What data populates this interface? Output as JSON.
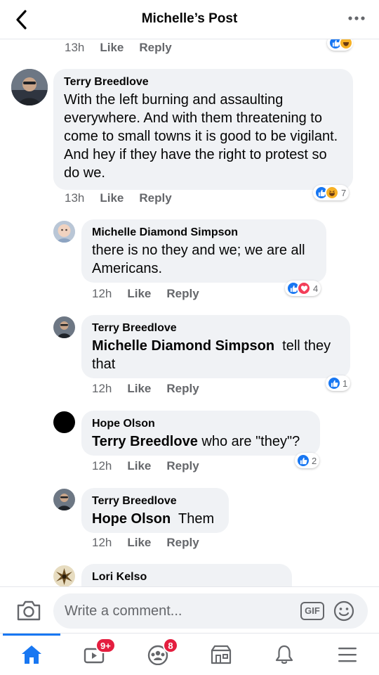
{
  "header": {
    "title": "Michelle’s Post"
  },
  "top_meta": {
    "time": "13h",
    "like": "Like",
    "reply": "Reply"
  },
  "comments": [
    {
      "author": "Terry Breedlove",
      "text": "With the left burning and assaulting everywhere. And with them threatening to come to small towns it is good to be vigilant. And hey if they have the right to protest so do we.",
      "time": "13h",
      "like": "Like",
      "reply": "Reply",
      "reactions": {
        "icons": [
          "like-icon",
          "haha-icon"
        ],
        "count": "7"
      }
    },
    {
      "author": "Michelle Diamond Simpson",
      "text": "there is no they and we; we are all Americans.",
      "time": "12h",
      "like": "Like",
      "reply": "Reply",
      "reactions": {
        "icons": [
          "like-icon",
          "love-icon"
        ],
        "count": "4"
      }
    },
    {
      "author": "Terry Breedlove",
      "mention": "Michelle Diamond Simpson",
      "text_after": "tell they",
      "text_line2": "that",
      "time": "12h",
      "like": "Like",
      "reply": "Reply",
      "reactions": {
        "icons": [
          "like-icon"
        ],
        "count": "1"
      }
    },
    {
      "author": "Hope Olson",
      "mention": "Terry Breedlove",
      "text_after": "who are \"they\"?",
      "time": "12h",
      "like": "Like",
      "reply": "Reply",
      "reactions": {
        "icons": [
          "like-icon"
        ],
        "count": "2"
      }
    },
    {
      "author": "Terry Breedlove",
      "mention": "Hope Olson",
      "text_after": "Them",
      "time": "12h",
      "like": "Like",
      "reply": "Reply"
    },
    {
      "author": "Lori Kelso"
    }
  ],
  "composer": {
    "placeholder": "Write a comment...",
    "gif_label": "GIF"
  },
  "nav": {
    "items": [
      "home-icon",
      "watch-icon",
      "groups-icon",
      "marketplace-icon",
      "notifications-icon",
      "menu-icon"
    ],
    "watch_badge": "9+",
    "groups_badge": "8"
  },
  "colors": {
    "accent": "#1877f2",
    "bubble": "#f0f2f5",
    "meta": "#65676b",
    "badge": "#e41e3f",
    "love": "#f33e58",
    "haha": "#f7b125"
  }
}
